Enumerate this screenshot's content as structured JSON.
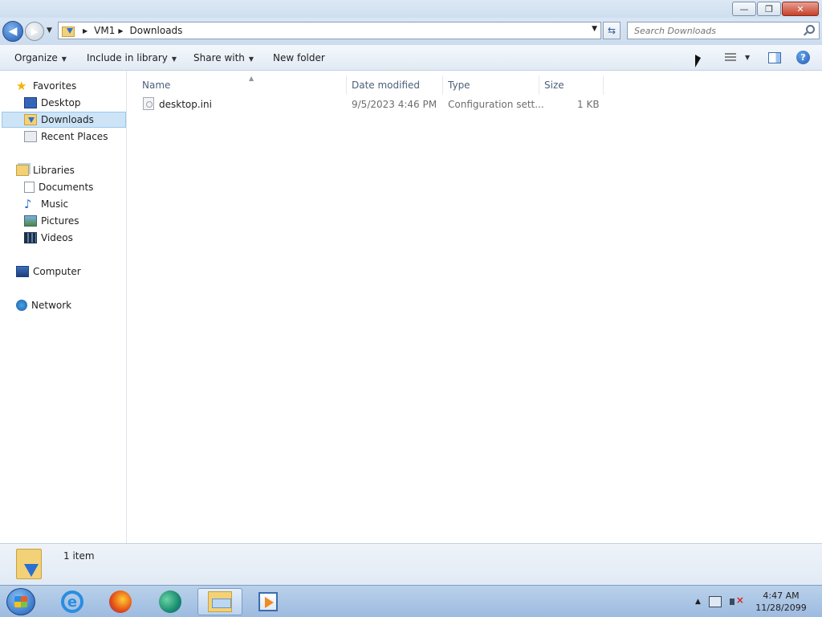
{
  "window": {
    "minimize_label": "—",
    "restore_label": "❐",
    "close_label": "✕"
  },
  "address": {
    "crumbs": [
      "VM1",
      "Downloads"
    ]
  },
  "search": {
    "placeholder": "Search Downloads"
  },
  "toolbar": {
    "organize": "Organize",
    "include_in_library": "Include in library",
    "share_with": "Share with",
    "new_folder": "New folder"
  },
  "nav": {
    "favorites": "Favorites",
    "desktop": "Desktop",
    "downloads": "Downloads",
    "recent_places": "Recent Places",
    "libraries": "Libraries",
    "documents": "Documents",
    "music": "Music",
    "pictures": "Pictures",
    "videos": "Videos",
    "computer": "Computer",
    "network": "Network"
  },
  "columns": {
    "name": "Name",
    "date_modified": "Date modified",
    "type": "Type",
    "size": "Size"
  },
  "files": [
    {
      "name": "desktop.ini",
      "date_modified": "9/5/2023 4:46 PM",
      "type": "Configuration sett...",
      "size": "1 KB"
    }
  ],
  "details": {
    "item_count": "1 item"
  },
  "taskbar": {
    "time": "4:47 AM",
    "date": "11/28/2099"
  }
}
